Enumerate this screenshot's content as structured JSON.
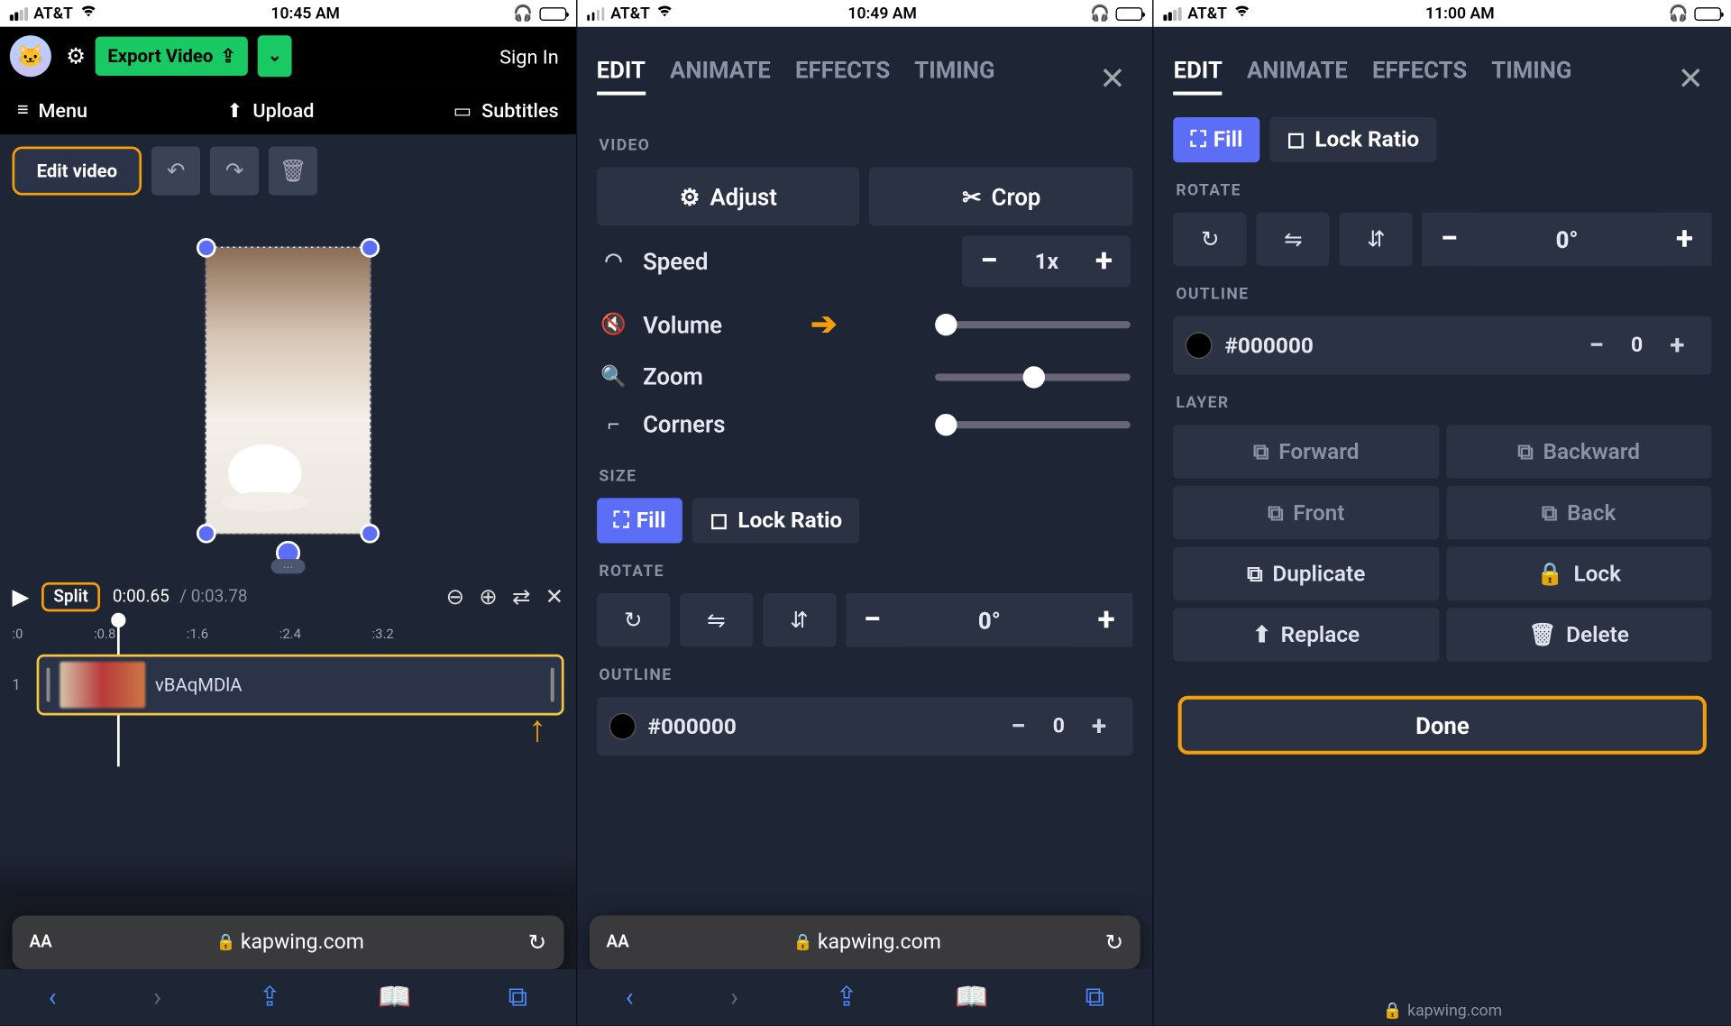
{
  "statusbars": [
    {
      "carrier": "AT&T",
      "time": "10:45 AM"
    },
    {
      "carrier": "AT&T",
      "time": "10:49 AM"
    },
    {
      "carrier": "AT&T",
      "time": "11:00 AM"
    }
  ],
  "phone1": {
    "export_label": "Export Video",
    "signin": "Sign In",
    "menu": "Menu",
    "upload": "Upload",
    "subtitles": "Subtitles",
    "edit_video": "Edit video",
    "split": "Split",
    "time_current": "0:00.65",
    "time_total": "0:03.78",
    "ruler": [
      ":0",
      ":0.8",
      ":1.6",
      ":2.4",
      ":3.2"
    ],
    "track_index": "1",
    "clip_name": "vBAqMDlA",
    "url": "kapwing.com",
    "aa": "AA"
  },
  "panel_tabs": [
    "EDIT",
    "ANIMATE",
    "EFFECTS",
    "TIMING"
  ],
  "phone2": {
    "section_video": "VIDEO",
    "adjust": "Adjust",
    "crop": "Crop",
    "speed_label": "Speed",
    "speed_value": "1x",
    "volume_label": "Volume",
    "zoom_label": "Zoom",
    "corners_label": "Corners",
    "section_size": "SIZE",
    "fill": "Fill",
    "lock_ratio": "Lock Ratio",
    "section_rotate": "ROTATE",
    "rotate_value": "0°",
    "section_outline": "OUTLINE",
    "outline_hex": "#000000",
    "outline_value": "0",
    "url": "kapwing.com",
    "aa": "AA"
  },
  "phone3": {
    "fill": "Fill",
    "lock_ratio": "Lock Ratio",
    "section_rotate": "ROTATE",
    "rotate_value": "0°",
    "section_outline": "OUTLINE",
    "outline_hex": "#000000",
    "outline_value": "0",
    "section_layer": "LAYER",
    "layer_buttons": [
      "Forward",
      "Backward",
      "Front",
      "Back",
      "Duplicate",
      "Lock",
      "Replace",
      "Delete"
    ],
    "done": "Done",
    "url": "kapwing.com"
  }
}
